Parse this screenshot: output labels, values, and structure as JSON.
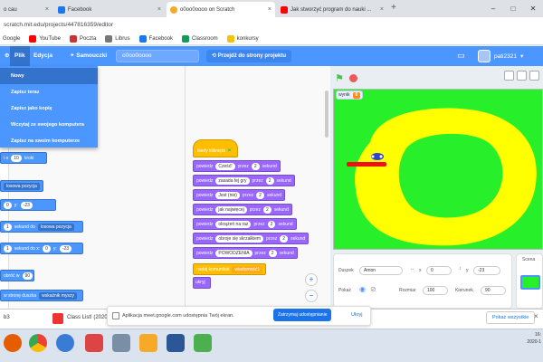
{
  "browser": {
    "tabs": [
      {
        "label": "o cau",
        "active": false
      },
      {
        "label": "Facebook",
        "active": false
      },
      {
        "label": "o0oo0oooo on Scratch",
        "active": true
      },
      {
        "label": "Jak stworzyć program do nauki ...",
        "active": false
      }
    ],
    "address": "scratch.mit.edu/projects/447816359/editor",
    "bookmarks": [
      "Google",
      "YouTube",
      "Poczta",
      "Librus",
      "Facebook",
      "Classroom",
      "konkursy"
    ]
  },
  "menubar": {
    "file": "Plik",
    "edit": "Edycja",
    "tutorials": "Samouczki",
    "project_title": "o0oo0oooo",
    "share": "Przejdź do strony projektu",
    "username": "pati2321"
  },
  "file_menu": [
    "Nowy",
    "Zapisz teraz",
    "Zapisz jako kopię",
    "Wczytaj ze swojego komputera",
    "Zapisz na swoim komputerze"
  ],
  "palette": {
    "steps_value": "10",
    "steps_label": "kroki",
    "random_position": "losowa pozycja",
    "x_label": "x:",
    "x_value": "0",
    "y_label": "y:",
    "y_value": "-23",
    "seconds_label": "sekund do",
    "seconds_value": "1",
    "target": "losowa pozycja",
    "seconds_to_xy": "sekund do x:",
    "xy_x": "0",
    "xy_y_label": "y:",
    "xy_y": "-23",
    "turn_label": "obróć w",
    "turn_value": "90",
    "pointer_label": "w stronę duszka",
    "pointer_target": "wskaźnik myszy"
  },
  "script": {
    "hat": "kiedy kliknięto",
    "say_label": "powiedz",
    "for_label": "przez",
    "seconds": "sekund",
    "lines": [
      {
        "text": "Cześć!",
        "secs": "2"
      },
      {
        "text": "zasada tej gry",
        "secs": "2"
      },
      {
        "text": "Jest (nie)",
        "secs": "2"
      },
      {
        "text": "jak najwięcej",
        "secs": "2"
      },
      {
        "text": "okrążeń na raz",
        "secs": "2"
      },
      {
        "text": "obroje się skrzałkiem",
        "secs": "2"
      },
      {
        "text": "POWODZENIA",
        "secs": "2"
      }
    ],
    "broadcast_label": "nadaj komunikat",
    "broadcast_value": "wiadomość1",
    "hide": "ukryj"
  },
  "stage": {
    "monitor_label": "wynik",
    "monitor_value": "0"
  },
  "sprite_info": {
    "sprite_label": "Duszek",
    "sprite_name": "Amon",
    "x_value": "0",
    "y_value": "-23",
    "show_label": "Pokaż",
    "size_label": "Rozmiar",
    "size_value": "100",
    "direction_label": "Kierunek",
    "direction_value": "90",
    "stage_label": "Scena"
  },
  "notification": {
    "text": "Aplikacja meet.google.com udostępnia Twój ekran.",
    "stop_button": "Zatrzymaj udostępnianie",
    "hide": "Ukryj"
  },
  "downloads": {
    "item1": "b3",
    "item2": "Class List! (2020-1....html",
    "show_all": "Pokaż wszystkie"
  },
  "clock": {
    "time": "16:",
    "date": "2020-1"
  },
  "colors": {
    "scratch_blue": "#4c97ff",
    "looks_purple": "#9966ff",
    "events_yellow": "#ffbf00",
    "stage_green": "#27f02b",
    "track_yellow": "#ffff00",
    "car_red": "#ee1111"
  }
}
